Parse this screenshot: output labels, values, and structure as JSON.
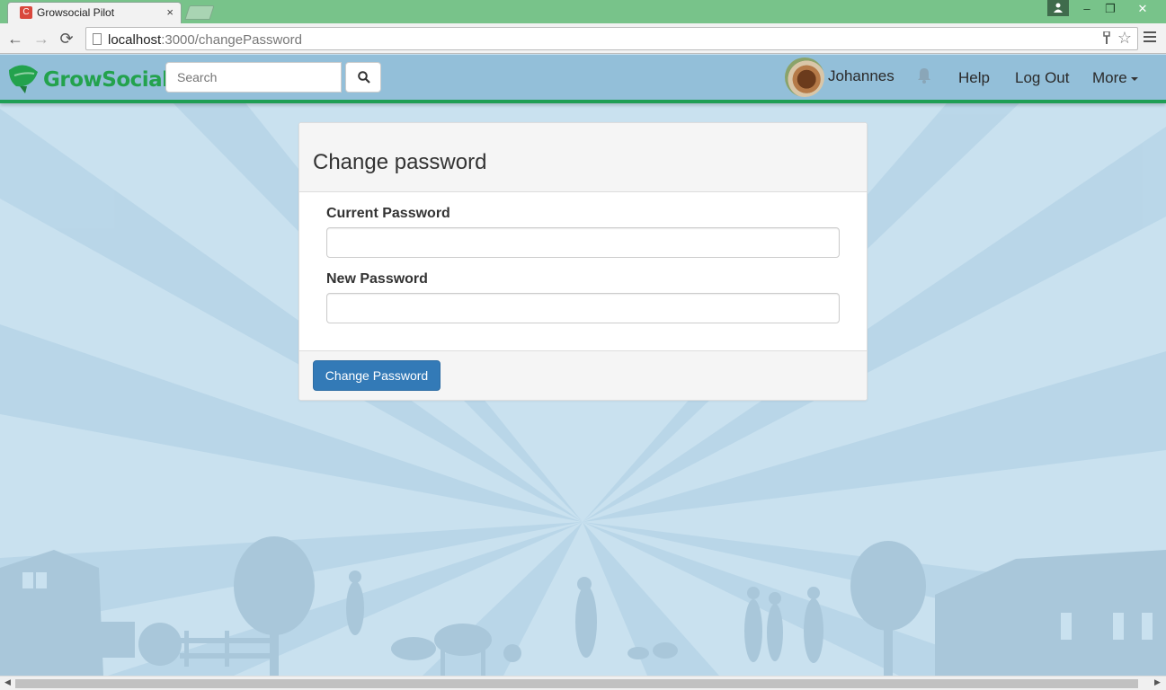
{
  "browser": {
    "tab_title": "Growsocial Pilot",
    "tab_favicon": "C",
    "tab_close": "×",
    "url_host": "localhost",
    "url_path": ":3000/changePassword",
    "win_minimize": "–",
    "win_restore": "❐",
    "win_close": "✕",
    "back": "←",
    "forward": "→",
    "reload": "⟳"
  },
  "navbar": {
    "brand": "GrowSocial",
    "search_placeholder": "Search",
    "user_name": "Johannes",
    "help_label": "Help",
    "logout_label": "Log Out",
    "more_label": "More"
  },
  "form": {
    "title": "Change password",
    "current_password_label": "Current Password",
    "new_password_label": "New Password",
    "submit_label": "Change Password"
  },
  "colors": {
    "brand_green": "#23a24d",
    "navbar_blue": "#93bfd9",
    "primary": "#337ab7"
  }
}
